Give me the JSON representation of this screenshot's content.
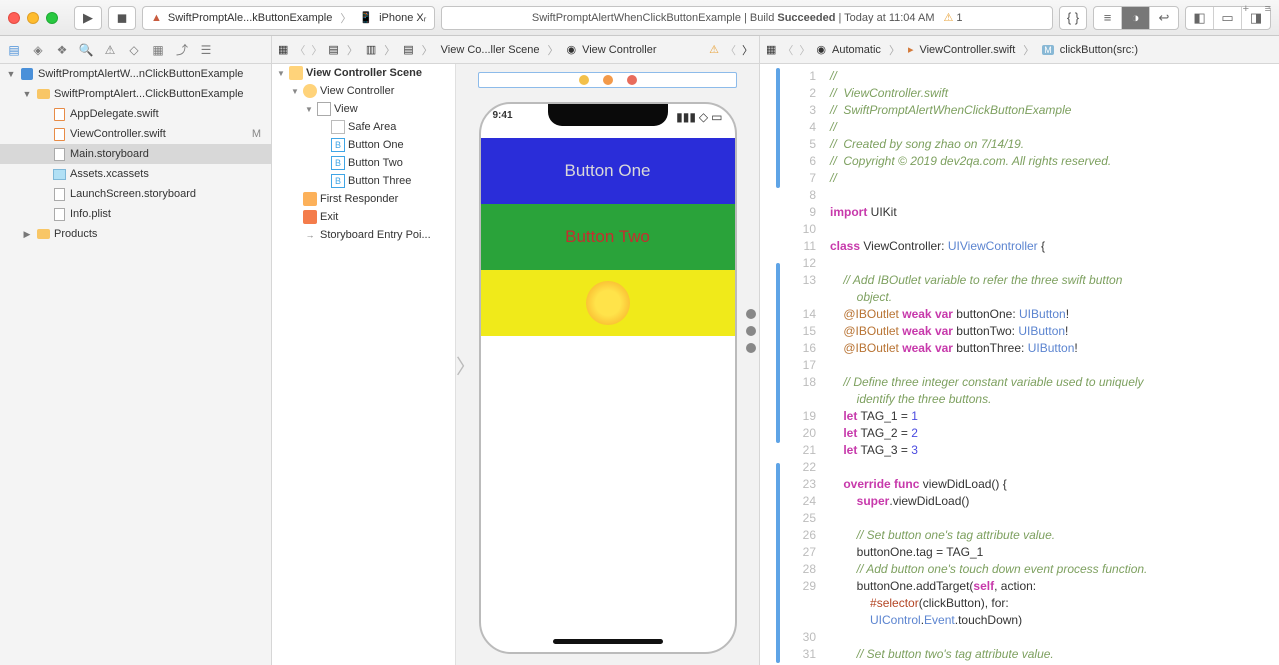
{
  "toolbar": {
    "scheme": "SwiftPromptAle...kButtonExample",
    "device": "iPhone Xᵣ",
    "status_prefix": "SwiftPromptAlertWhenClickButtonExample | Build ",
    "status_result": "Succeeded",
    "status_suffix": " | Today at 11:04 AM",
    "warn_count": "1"
  },
  "navigator": {
    "items": [
      {
        "label": "SwiftPromptAlertW...nClickButtonExample",
        "indent": 0,
        "disc": "▼",
        "icon": "proj"
      },
      {
        "label": "SwiftPromptAlert...ClickButtonExample",
        "indent": 1,
        "disc": "▼",
        "icon": "folder"
      },
      {
        "label": "AppDelegate.swift",
        "indent": 2,
        "disc": "",
        "icon": "swift"
      },
      {
        "label": "ViewController.swift",
        "indent": 2,
        "disc": "",
        "icon": "swift",
        "badge": "M"
      },
      {
        "label": "Main.storyboard",
        "indent": 2,
        "disc": "",
        "icon": "sb",
        "sel": true
      },
      {
        "label": "Assets.xcassets",
        "indent": 2,
        "disc": "",
        "icon": "xc"
      },
      {
        "label": "LaunchScreen.storyboard",
        "indent": 2,
        "disc": "",
        "icon": "sb"
      },
      {
        "label": "Info.plist",
        "indent": 2,
        "disc": "",
        "icon": "plist"
      },
      {
        "label": "Products",
        "indent": 1,
        "disc": "▶",
        "icon": "folder"
      }
    ]
  },
  "jumpbar_center": {
    "items": [
      "View Co...ller Scene",
      "View Controller"
    ]
  },
  "jumpbar_right": {
    "mode": "Automatic",
    "file": "ViewController.swift",
    "symbol": "clickButton(src:)"
  },
  "outline": {
    "items": [
      {
        "label": "View Controller Scene",
        "indent": 0,
        "disc": "▼",
        "t": "scene",
        "bold": true
      },
      {
        "label": "View Controller",
        "indent": 1,
        "disc": "▼",
        "t": "vc"
      },
      {
        "label": "View",
        "indent": 2,
        "disc": "▼",
        "t": "view"
      },
      {
        "label": "Safe Area",
        "indent": 3,
        "disc": "",
        "t": "sa"
      },
      {
        "label": "Button One",
        "indent": 3,
        "disc": "",
        "t": "btn"
      },
      {
        "label": "Button Two",
        "indent": 3,
        "disc": "",
        "t": "btn"
      },
      {
        "label": "Button Three",
        "indent": 3,
        "disc": "",
        "t": "btn"
      },
      {
        "label": "First Responder",
        "indent": 1,
        "disc": "",
        "t": "fr"
      },
      {
        "label": "Exit",
        "indent": 1,
        "disc": "",
        "t": "exit"
      },
      {
        "label": "Storyboard Entry Poi...",
        "indent": 1,
        "disc": "",
        "t": "ep"
      }
    ]
  },
  "phone": {
    "time": "9:41",
    "btn1": "Button One",
    "btn2": "Button Two"
  },
  "code": {
    "lines": [
      {
        "n": 1,
        "h": "<span class='c-comment'>//</span>"
      },
      {
        "n": 2,
        "h": "<span class='c-comment'>//  ViewController.swift</span>"
      },
      {
        "n": 3,
        "h": "<span class='c-comment'>//  SwiftPromptAlertWhenClickButtonExample</span>"
      },
      {
        "n": 4,
        "h": "<span class='c-comment'>//</span>"
      },
      {
        "n": 5,
        "h": "<span class='c-comment'>//  Created by song zhao on 7/14/19.</span>"
      },
      {
        "n": 6,
        "h": "<span class='c-comment'>//  Copyright © 2019 dev2qa.com. All rights reserved.</span>"
      },
      {
        "n": 7,
        "h": "<span class='c-comment'>//</span>"
      },
      {
        "n": 8,
        "h": ""
      },
      {
        "n": 9,
        "h": "<span class='c-key'>import</span> UIKit"
      },
      {
        "n": 10,
        "h": ""
      },
      {
        "n": 11,
        "h": "<span class='c-key'>class</span> ViewController: <span class='c-type'>UIViewController</span> {"
      },
      {
        "n": 12,
        "h": ""
      },
      {
        "n": 13,
        "h": "    <span class='c-comment'>// Add IBOutlet variable to refer the three swift button</span>"
      },
      {
        "n": "",
        "h": "        <span class='c-comment'>object.</span>"
      },
      {
        "n": 14,
        "h": "    <span class='c-attr'>@IBOutlet</span> <span class='c-key'>weak</span> <span class='c-key'>var</span> buttonOne: <span class='c-type'>UIButton</span>!",
        "conn": "f"
      },
      {
        "n": 15,
        "h": "    <span class='c-attr'>@IBOutlet</span> <span class='c-key'>weak</span> <span class='c-key'>var</span> buttonTwo: <span class='c-type'>UIButton</span>!",
        "conn": "f"
      },
      {
        "n": 16,
        "h": "    <span class='c-attr'>@IBOutlet</span> <span class='c-key'>weak</span> <span class='c-key'>var</span> buttonThree: <span class='c-type'>UIButton</span>!",
        "conn": "f"
      },
      {
        "n": 17,
        "h": ""
      },
      {
        "n": 18,
        "h": "    <span class='c-comment'>// Define three integer constant variable used to uniquely</span>"
      },
      {
        "n": "",
        "h": "        <span class='c-comment'>identify the three buttons.</span>"
      },
      {
        "n": 19,
        "h": "    <span class='c-key'>let</span> TAG_1 = <span class='c-num'>1</span>"
      },
      {
        "n": 20,
        "h": "    <span class='c-key'>let</span> TAG_2 = <span class='c-num'>2</span>"
      },
      {
        "n": 21,
        "h": "    <span class='c-key'>let</span> TAG_3 = <span class='c-num'>3</span>"
      },
      {
        "n": 22,
        "h": ""
      },
      {
        "n": 23,
        "h": "    <span class='c-key'>override</span> <span class='c-key'>func</span> viewDidLoad() {"
      },
      {
        "n": 24,
        "h": "        <span class='c-key'>super</span>.viewDidLoad()"
      },
      {
        "n": 25,
        "h": ""
      },
      {
        "n": 26,
        "h": "        <span class='c-comment'>// Set button one's tag attribute value.</span>"
      },
      {
        "n": 27,
        "h": "        buttonOne.tag = TAG_1"
      },
      {
        "n": 28,
        "h": "        <span class='c-comment'>// Add button one's touch down event process function.</span>"
      },
      {
        "n": 29,
        "h": "        buttonOne.addTarget(<span class='c-key'>self</span>, action:"
      },
      {
        "n": "",
        "h": "            <span class='c-sel'>#selector</span>(clickButton), for:"
      },
      {
        "n": "",
        "h": "            <span class='c-type'>UIControl</span>.<span class='c-type'>Event</span>.touchDown)"
      },
      {
        "n": 30,
        "h": ""
      },
      {
        "n": 31,
        "h": "        <span class='c-comment'>// Set button two's tag attribute value.</span>"
      }
    ]
  }
}
